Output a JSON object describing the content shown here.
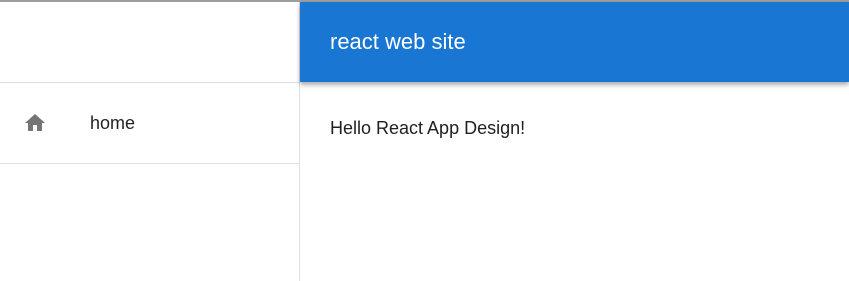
{
  "appbar": {
    "title": "react web site",
    "color": "#1976d2"
  },
  "drawer": {
    "items": [
      {
        "icon": "home-icon",
        "label": "home"
      }
    ]
  },
  "main": {
    "content": "Hello React App Design!"
  }
}
